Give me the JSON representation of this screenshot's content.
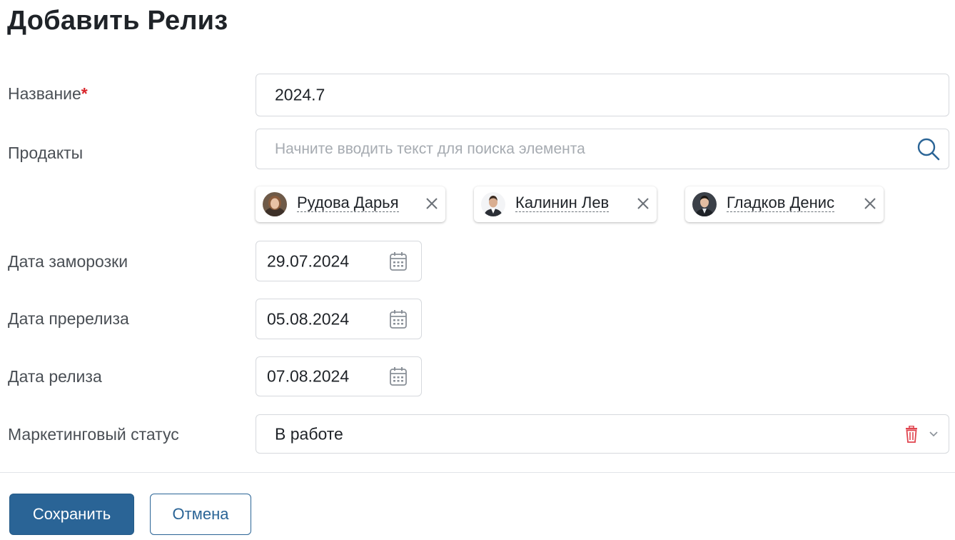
{
  "page": {
    "title": "Добавить Релиз"
  },
  "form": {
    "name": {
      "label": "Название",
      "required_mark": "*",
      "value": "2024.7"
    },
    "products": {
      "label": "Продакты",
      "placeholder": "Начните вводить текст для поиска элемента",
      "icon": "search-icon",
      "selected": [
        {
          "name": "Рудова Дарья"
        },
        {
          "name": "Калинин Лев"
        },
        {
          "name": "Гладков Денис"
        }
      ]
    },
    "freeze_date": {
      "label": "Дата заморозки",
      "value": "29.07.2024",
      "icon": "calendar-icon"
    },
    "prerelease_date": {
      "label": "Дата пререлиза",
      "value": "05.08.2024",
      "icon": "calendar-icon"
    },
    "release_date": {
      "label": "Дата релиза",
      "value": "07.08.2024",
      "icon": "calendar-icon"
    },
    "marketing_status": {
      "label": "Маркетинговый статус",
      "value": "В работе",
      "clear_icon": "trash-icon",
      "open_icon": "chevron-down-icon"
    }
  },
  "actions": {
    "save_label": "Сохранить",
    "cancel_label": "Отмена"
  },
  "colors": {
    "primary": "#2a6496",
    "required": "#d9262c",
    "trash": "#e0454f",
    "border": "#d6d9dd"
  }
}
